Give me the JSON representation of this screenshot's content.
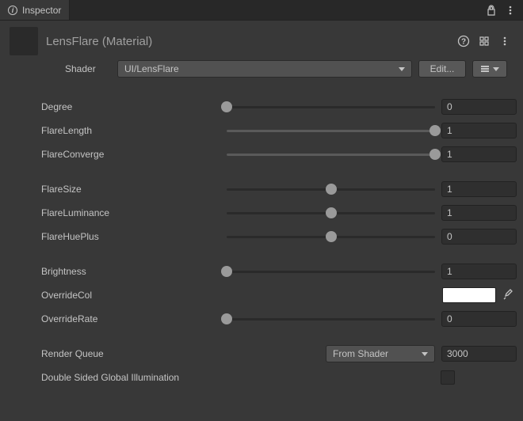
{
  "tab": {
    "label": "Inspector"
  },
  "material": {
    "title": "LensFlare (Material)",
    "shader_label": "Shader",
    "shader_value": "UI/LensFlare",
    "edit_label": "Edit..."
  },
  "props": {
    "degree": {
      "label": "Degree",
      "value": "0",
      "pos": 0
    },
    "flareLength": {
      "label": "FlareLength",
      "value": "1",
      "pos": 100
    },
    "flareConverge": {
      "label": "FlareConverge",
      "value": "1",
      "pos": 100
    },
    "flareSize": {
      "label": "FlareSize",
      "value": "1",
      "pos": 50
    },
    "flareLuminance": {
      "label": "FlareLuminance",
      "value": "1",
      "pos": 50
    },
    "flareHuePlus": {
      "label": "FlareHuePlus",
      "value": "0",
      "pos": 50
    },
    "brightness": {
      "label": "Brightness",
      "value": "1",
      "pos": 0
    },
    "overrideCol": {
      "label": "OverrideCol",
      "color": "#ffffff"
    },
    "overrideRate": {
      "label": "OverrideRate",
      "value": "0",
      "pos": 0
    }
  },
  "renderQueue": {
    "label": "Render Queue",
    "mode": "From Shader",
    "value": "3000"
  },
  "doubleSided": {
    "label": "Double Sided Global Illumination",
    "checked": false
  }
}
